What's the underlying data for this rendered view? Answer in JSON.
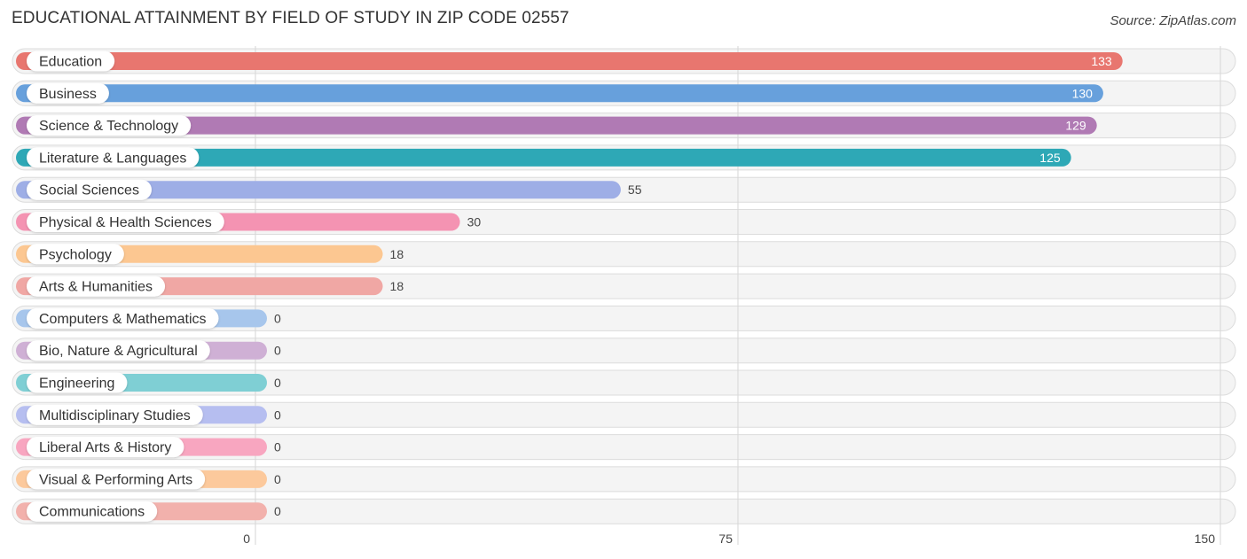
{
  "chart_data": {
    "type": "bar",
    "orientation": "horizontal",
    "title": "EDUCATIONAL ATTAINMENT BY FIELD OF STUDY IN ZIP CODE 02557",
    "source": "Source: ZipAtlas.com",
    "xlabel": "",
    "ylabel": "",
    "xlim": [
      0,
      150
    ],
    "xticks": [
      0,
      75,
      150
    ],
    "xtick_labels": [
      "0",
      "75",
      "150"
    ],
    "grid": true,
    "legend": "none",
    "categories": [
      "Education",
      "Business",
      "Science & Technology",
      "Literature & Languages",
      "Social Sciences",
      "Physical & Health Sciences",
      "Psychology",
      "Arts & Humanities",
      "Computers & Mathematics",
      "Bio, Nature & Agricultural",
      "Engineering",
      "Multidisciplinary Studies",
      "Liberal Arts & History",
      "Visual & Performing Arts",
      "Communications"
    ],
    "values": [
      133,
      130,
      129,
      125,
      55,
      30,
      18,
      18,
      0,
      0,
      0,
      0,
      0,
      0,
      0
    ],
    "value_labels": [
      "133",
      "130",
      "129",
      "125",
      "55",
      "30",
      "18",
      "18",
      "0",
      "0",
      "0",
      "0",
      "0",
      "0",
      "0"
    ],
    "colors": [
      "#e8766f",
      "#67a0dc",
      "#b07ab4",
      "#2ea8b6",
      "#9eaee6",
      "#f493b2",
      "#fcc791",
      "#f0a7a4",
      "#a7c6ec",
      "#cfb0d5",
      "#7fcfd4",
      "#b6bef0",
      "#f8a6c0",
      "#fcc99c",
      "#f2b1ac"
    ]
  }
}
